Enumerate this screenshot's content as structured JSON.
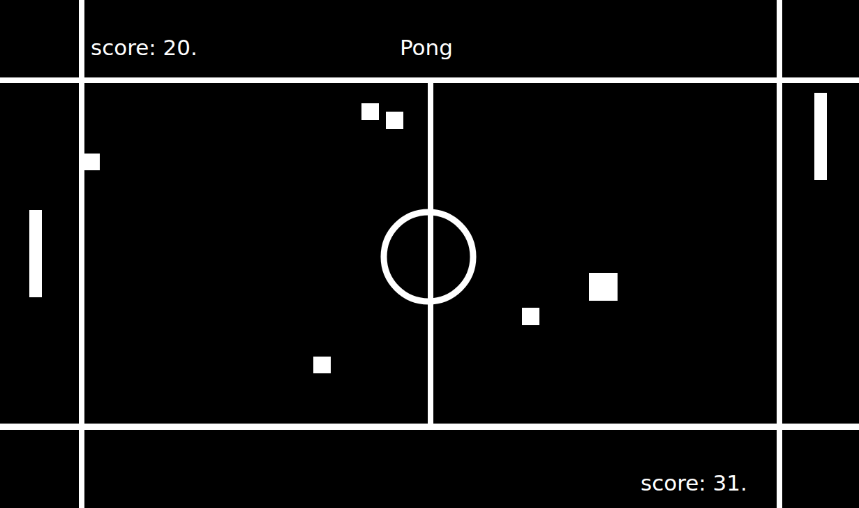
{
  "title": "Pong",
  "scores": [
    {
      "player": "left",
      "text": "score: 20."
    },
    {
      "player": "right",
      "text": "score: 31."
    }
  ]
}
